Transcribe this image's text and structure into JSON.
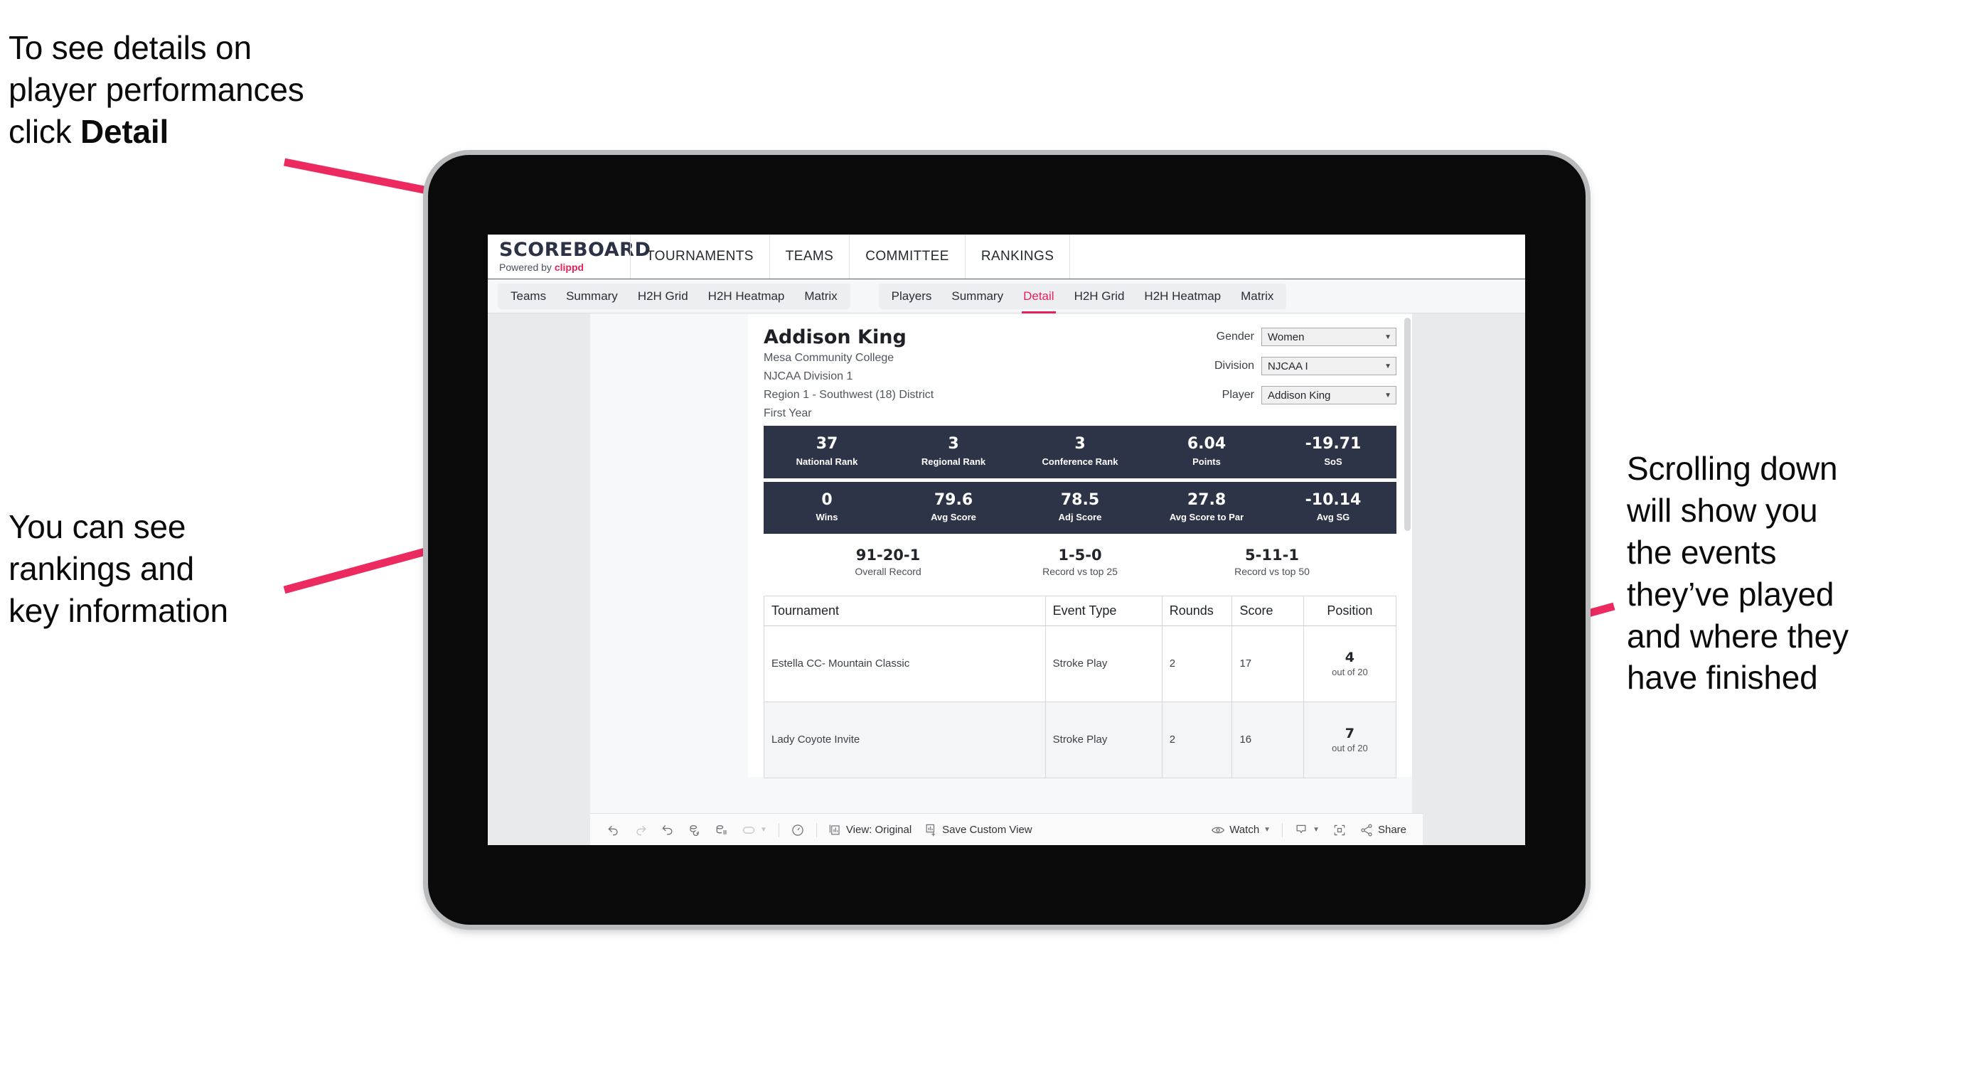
{
  "annotations": {
    "top_left": {
      "line1": "To see details on",
      "line2": "player performances",
      "line3_prefix": "click ",
      "line3_bold": "Detail"
    },
    "mid_left": {
      "line1": "You can see",
      "line2": "rankings and",
      "line3": "key information"
    },
    "right": {
      "line1": "Scrolling down",
      "line2": "will show you",
      "line3": "the events",
      "line4": "they’ve played",
      "line5": "and where they",
      "line6": "have finished"
    }
  },
  "app": {
    "brand": {
      "title": "SCOREBOARD",
      "powered_prefix": "Powered by ",
      "powered_brand": "clippd"
    },
    "top_nav": [
      "TOURNAMENTS",
      "TEAMS",
      "COMMITTEE",
      "RANKINGS"
    ],
    "sub_nav_group1": [
      "Teams",
      "Summary",
      "H2H Grid",
      "H2H Heatmap",
      "Matrix"
    ],
    "sub_nav_group2": [
      "Players",
      "Summary",
      "Detail",
      "H2H Grid",
      "H2H Heatmap",
      "Matrix"
    ],
    "active_sub_tab": "Detail"
  },
  "player": {
    "name": "Addison King",
    "school": "Mesa Community College",
    "division": "NJCAA Division 1",
    "region": "Region 1 - Southwest (18) District",
    "class_year": "First Year"
  },
  "filters": [
    {
      "label": "Gender",
      "value": "Women"
    },
    {
      "label": "Division",
      "value": "NJCAA I"
    },
    {
      "label": "Player",
      "value": "Addison King"
    }
  ],
  "stats_band_1": [
    {
      "value": "37",
      "label": "National Rank"
    },
    {
      "value": "3",
      "label": "Regional Rank"
    },
    {
      "value": "3",
      "label": "Conference Rank"
    },
    {
      "value": "6.04",
      "label": "Points"
    },
    {
      "value": "-19.71",
      "label": "SoS"
    }
  ],
  "stats_band_2": [
    {
      "value": "0",
      "label": "Wins"
    },
    {
      "value": "79.6",
      "label": "Avg Score"
    },
    {
      "value": "78.5",
      "label": "Adj Score"
    },
    {
      "value": "27.8",
      "label": "Avg Score to Par"
    },
    {
      "value": "-10.14",
      "label": "Avg SG"
    }
  ],
  "records": [
    {
      "value": "91-20-1",
      "label": "Overall Record"
    },
    {
      "value": "1-5-0",
      "label": "Record vs top 25"
    },
    {
      "value": "5-11-1",
      "label": "Record vs top 50"
    }
  ],
  "tournament_table": {
    "headers": [
      "Tournament",
      "Event Type",
      "Rounds",
      "Score",
      "Position"
    ],
    "rows": [
      {
        "tournament": "Estella CC- Mountain Classic",
        "event_type": "Stroke Play",
        "rounds": "2",
        "score": "17",
        "position": "4",
        "position_sub": "out of 20"
      },
      {
        "tournament": "Lady Coyote Invite",
        "event_type": "Stroke Play",
        "rounds": "2",
        "score": "16",
        "position": "7",
        "position_sub": "out of 20"
      }
    ]
  },
  "toolbar": {
    "view_label": "View: Original",
    "save_label": "Save Custom View",
    "watch_label": "Watch",
    "share_label": "Share"
  },
  "colors": {
    "accent_pink": "#e8215b",
    "band_navy": "#2e3447",
    "annotation_arrow": "#ec2a60"
  }
}
